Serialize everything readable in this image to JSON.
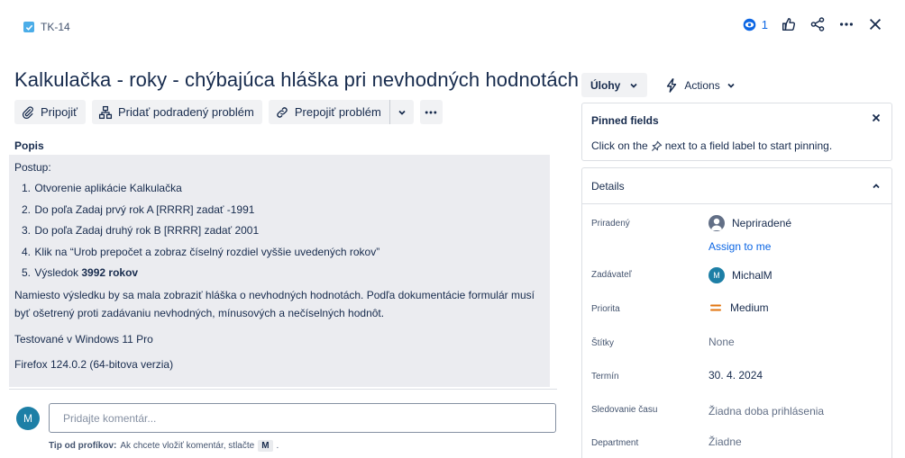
{
  "header": {
    "issue_key": "TK-14",
    "watchers_count": "1"
  },
  "issue": {
    "title": "Kalkulačka - roky - chýbajúca hláška pri nevhodných hodnotách"
  },
  "toolbar": {
    "attach_label": "Pripojiť",
    "add_child_label": "Pridať podradený problém",
    "link_label": "Prepojiť problém"
  },
  "description": {
    "label": "Popis",
    "intro": "Postup:",
    "steps": [
      {
        "n": "1.",
        "text": "Otvorenie aplikácie Kalkulačka"
      },
      {
        "n": "2.",
        "text": "Do poľa Zadaj prvý rok A [RRRR] zadať -1991"
      },
      {
        "n": "3.",
        "text": "Do poľa Zadaj druhý rok B [RRRR] zadať 2001"
      },
      {
        "n": "4.",
        "text": "Klik na “Urob prepočet a zobraz číselný rozdiel vyššie uvedených rokov”"
      },
      {
        "n": "5.",
        "text": "Výsledok ",
        "bold": "3992 rokov"
      }
    ],
    "paragraph": "Namiesto výsledku by sa mala zobraziť hláška o nevhodných hodnotách. Podľa dokumentácie formulár musí byť ošetrený proti zadávaniu nevhodných, mínusových a nečíselných hodnôt.",
    "tested": "Testované v Windows 11 Pro",
    "browser": "Firefox 124.0.2 (64-bitova verzia)"
  },
  "comment": {
    "avatar_initial": "M",
    "placeholder": "Pridajte komentár...",
    "tip_bold": "Tip od profíkov:",
    "tip_text": "Ak chcete vložiť komentár, stlačte",
    "tip_key": "M",
    "tip_end": "."
  },
  "side": {
    "tasks_label": "Úlohy",
    "actions_label": "Actions",
    "pinned": {
      "title": "Pinned fields",
      "text_before": "Click on the",
      "text_after": "next to a field label to start pinning."
    },
    "details": {
      "title": "Details",
      "fields": {
        "assignee_label": "Priradený",
        "assignee_value": "Nepriradené",
        "assign_to_me": "Assign to me",
        "reporter_label": "Zadávateľ",
        "reporter_initial": "M",
        "reporter_value": "MichalM",
        "priority_label": "Priorita",
        "priority_value": "Medium",
        "labels_label": "Štítky",
        "labels_value": "None",
        "due_label": "Termín",
        "due_value": "30. 4. 2024",
        "time_label": "Sledovanie času",
        "time_value": "Žiadna doba prihlásenia",
        "department_label": "Department",
        "department_value": "Žiadne"
      }
    }
  },
  "colors": {
    "brand_blue": "#0c66e4",
    "priority_medium": "#e2740f",
    "avatar_teal": "#1d7fa6"
  }
}
